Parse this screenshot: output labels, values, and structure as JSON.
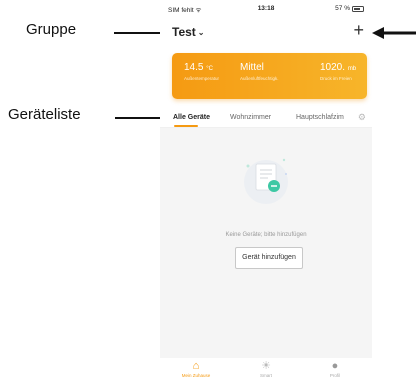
{
  "annotations": {
    "group_label": "Gruppe",
    "device_list_label": "Geräteliste"
  },
  "status_bar": {
    "carrier": "SIM fehlt ᯤ",
    "time": "13:18",
    "battery": "57 %"
  },
  "header": {
    "group_name": "Test",
    "add_symbol": "+"
  },
  "weather": {
    "items": [
      {
        "value": "14.5",
        "unit": "°C",
        "label": "Außentemperatur"
      },
      {
        "value": "Mittel",
        "unit": "",
        "label": "Außenluftfeuchtigk."
      },
      {
        "value": "1020.",
        "unit": "mb",
        "label": "Druck im Freien"
      }
    ],
    "colors": {
      "start": "#f59a12",
      "end": "#f7b52a"
    }
  },
  "tabs": [
    {
      "label": "Alle Geräte",
      "active": true
    },
    {
      "label": "Wohnzimmer",
      "active": false
    },
    {
      "label": "Hauptschlafzim",
      "active": false
    }
  ],
  "empty_state": {
    "message": "Keine Geräte; bitte hinzufügen",
    "button_label": "Gerät hinzufügen"
  },
  "bottom_nav": [
    {
      "label": "Mein Zuhause",
      "icon": "home-icon",
      "active": true
    },
    {
      "label": "Smart",
      "icon": "sun-icon",
      "active": false
    },
    {
      "label": "Profil",
      "icon": "profile-icon",
      "active": false
    }
  ],
  "accent_color": "#f59a12"
}
